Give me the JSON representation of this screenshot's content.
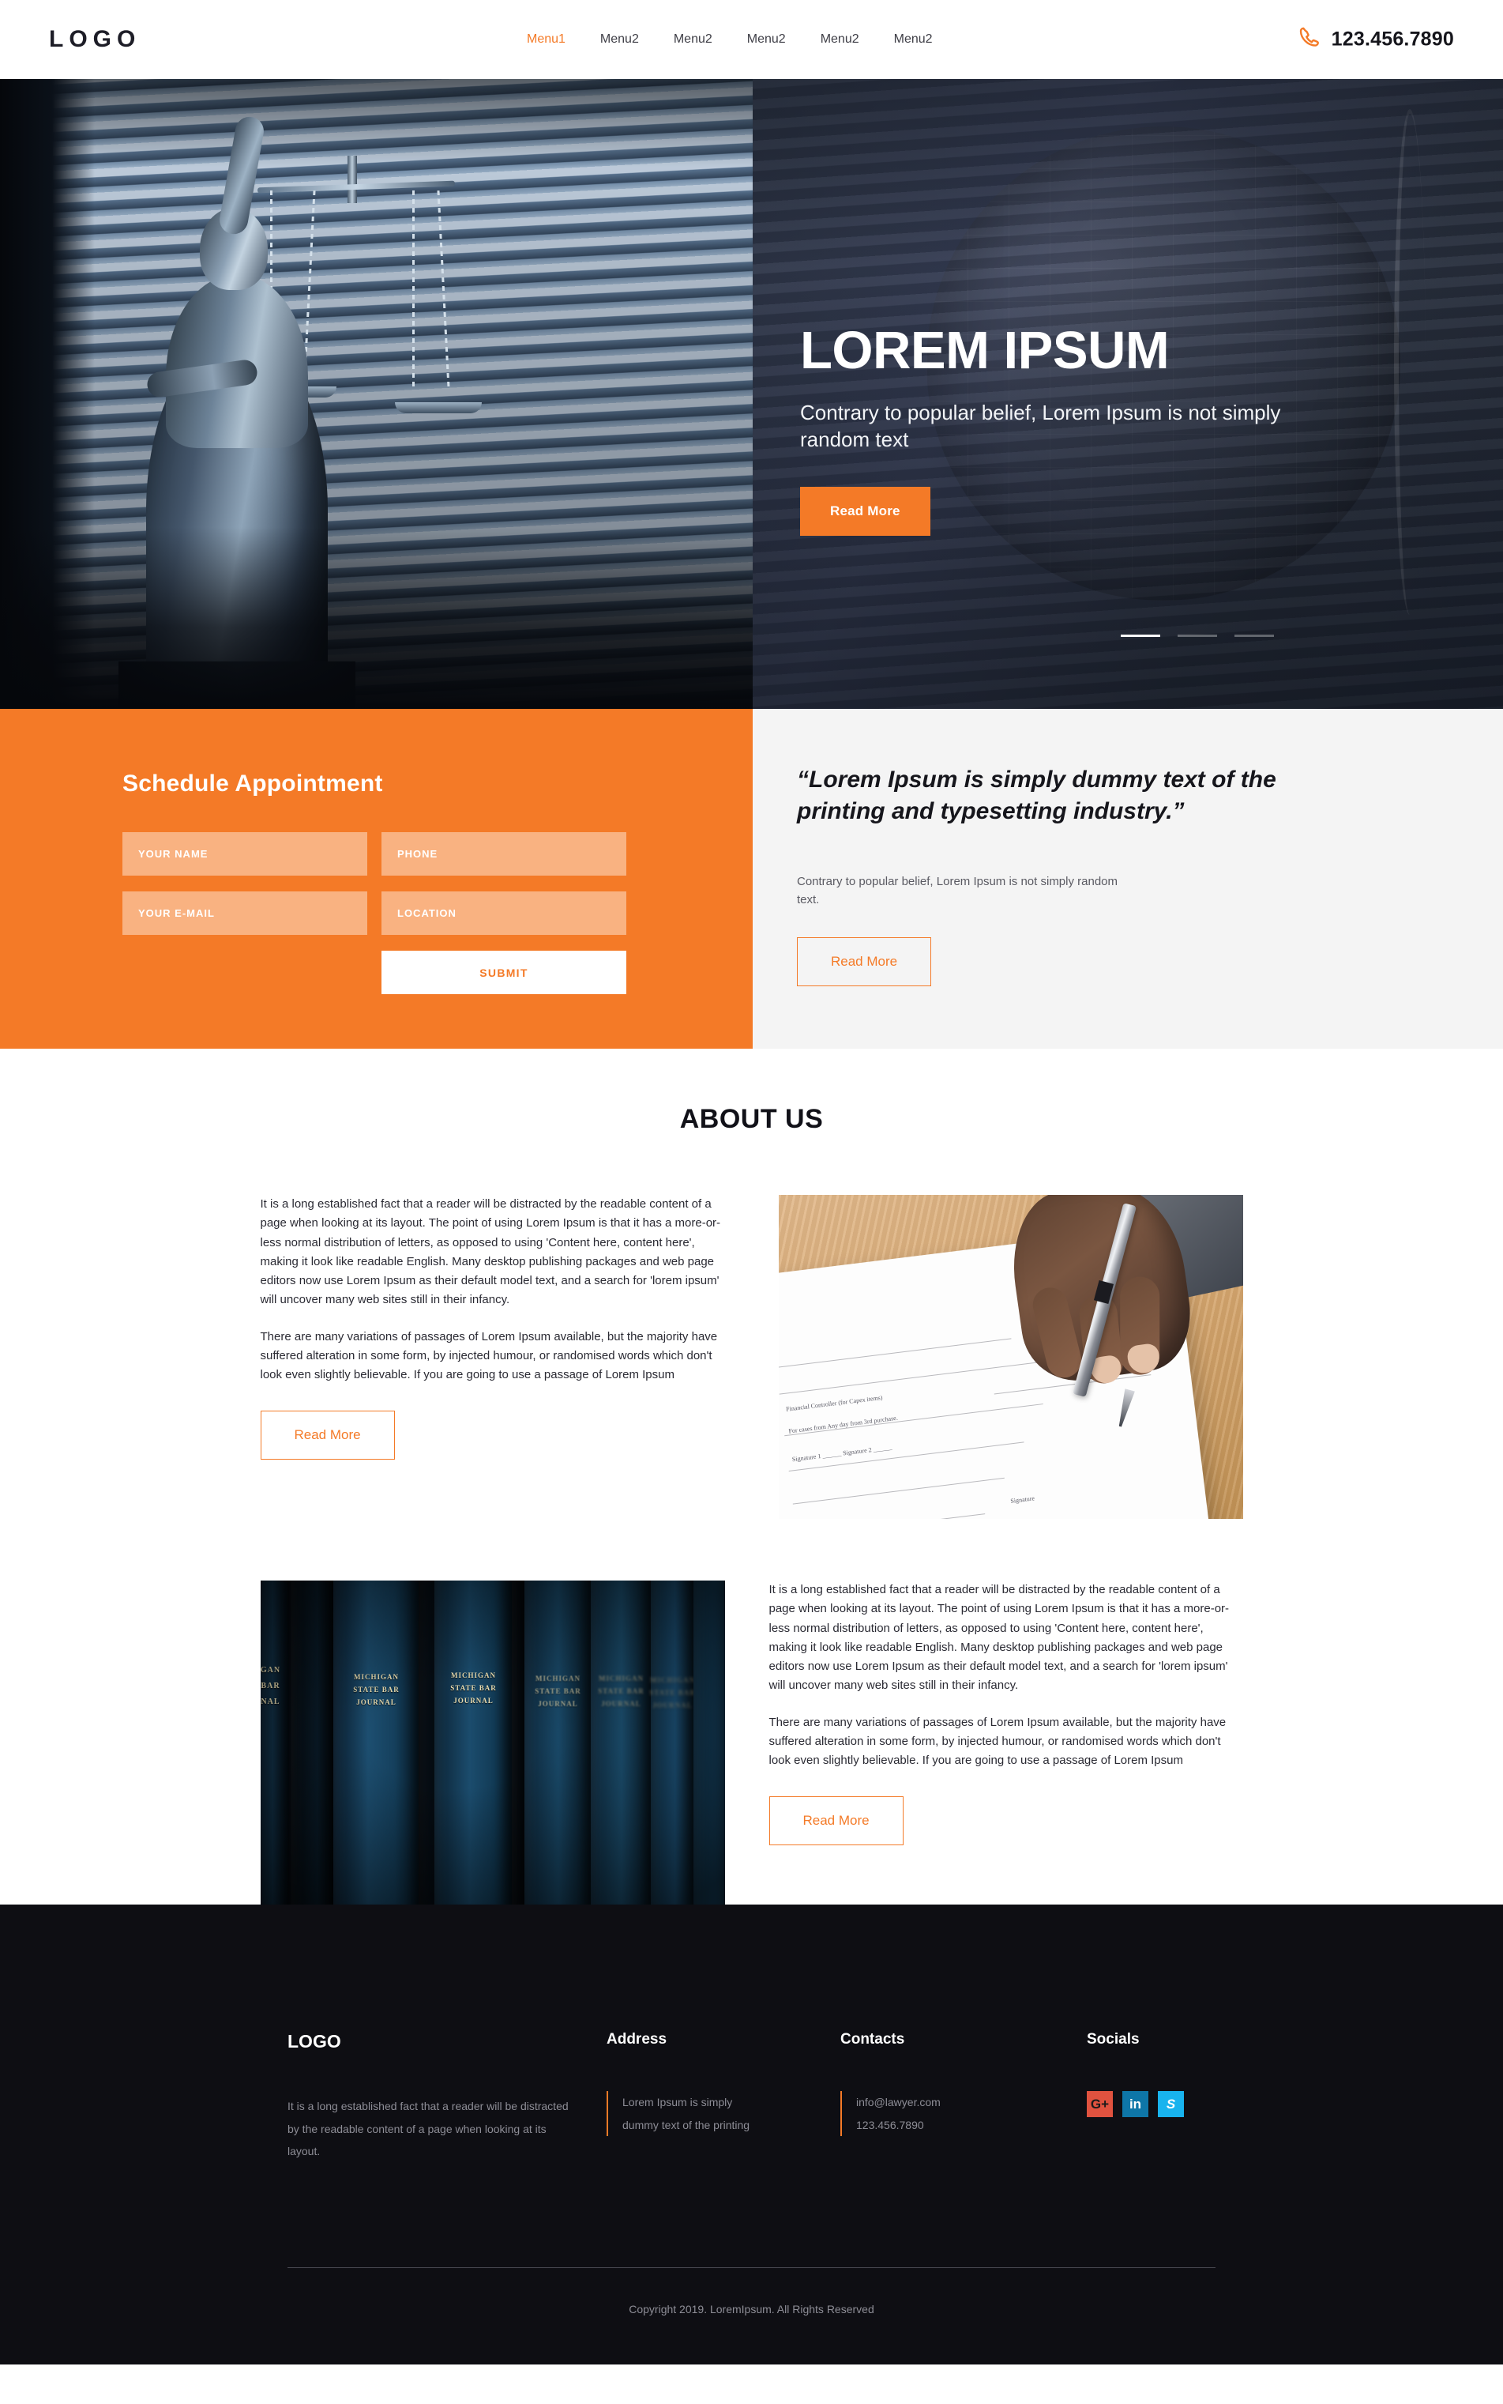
{
  "header": {
    "logo": "LOGO",
    "nav": [
      {
        "label": "Menu1",
        "active": true
      },
      {
        "label": "Menu2",
        "active": false
      },
      {
        "label": "Menu2",
        "active": false
      },
      {
        "label": "Menu2",
        "active": false
      },
      {
        "label": "Menu2",
        "active": false
      },
      {
        "label": "Menu2",
        "active": false
      }
    ],
    "phone": "123.456.7890",
    "phone_icon": "phone-icon"
  },
  "hero": {
    "title": "LOREM IPSUM",
    "subtitle": "Contrary to popular belief, Lorem Ipsum is not simply random text",
    "cta": "Read More",
    "slides": [
      {
        "active": true
      },
      {
        "active": false
      },
      {
        "active": false
      }
    ],
    "left_image_alt": "lady-justice-statue-blinds",
    "right_image_alt": "globe-behind-blinds"
  },
  "appointment": {
    "title": "Schedule Appointment",
    "fields": [
      {
        "name": "your-name",
        "placeholder": "YOUR NAME",
        "value": ""
      },
      {
        "name": "phone",
        "placeholder": "PHONE",
        "value": ""
      },
      {
        "name": "your-email",
        "placeholder": "YOUR E-MAIL",
        "value": ""
      },
      {
        "name": "location",
        "placeholder": "LOCATION",
        "value": ""
      }
    ],
    "submit": "SUBMIT"
  },
  "quote_panel": {
    "quote": "“Lorem Ipsum is simply dummy text of the printing and typesetting industry.”",
    "body": "Contrary to popular belief, Lorem Ipsum is not simply random text.",
    "cta": "Read More"
  },
  "about": {
    "title": "ABOUT US",
    "block1": {
      "p1": "It is a long established fact that a reader will be distracted by the readable content of a page when looking at its layout. The point of using Lorem Ipsum is that it has a more-or-less normal distribution of letters, as opposed to using 'Content here, content here', making it look like readable English. Many desktop publishing packages and web page editors now use Lorem Ipsum as their default model text, and a search for 'lorem ipsum' will uncover many web sites still in their infancy.",
      "p2": "There are many variations of passages of Lorem Ipsum available, but the majority have suffered alteration in some form, by injected humour, or randomised words which don't look even slightly believable. If you are going to use a passage of Lorem Ipsum",
      "cta": "Read More",
      "image_alt": "hand-signing-document"
    },
    "block2": {
      "p1": "It is a long established fact that a reader will be distracted by the readable content of a page when looking at its layout. The point of using Lorem Ipsum is that it has a more-or-less normal distribution of letters, as opposed to using 'Content here, content here', making it look like readable English. Many desktop publishing packages and web page editors now use Lorem Ipsum as their default model text, and a search for 'lorem ipsum' will uncover many web sites still in their infancy.",
      "p2": "There are many variations of passages of Lorem Ipsum available, but the majority have suffered alteration in some form, by injected humour, or randomised words which don't look even slightly believable. If you are going to use a passage of Lorem Ipsum",
      "cta": "Read More",
      "image_alt": "michigan-state-bar-journal-books",
      "book_labels": [
        "MICHIGAN STATE BAR JOURNAL",
        "MICHIGAN STATE BAR JOURNAL"
      ]
    }
  },
  "footer": {
    "logo": "LOGO",
    "logo_text": "It is a long established fact that a reader will be distracted by the readable content of a page when looking at its layout.",
    "address_head": "Address",
    "address_text": "Lorem Ipsum is simply dummy text of the printing",
    "contacts_head": "Contacts",
    "contacts_email": "info@lawyer.com",
    "contacts_phone": "123.456.7890",
    "socials_head": "Socials",
    "socials": [
      {
        "name": "google-plus-icon",
        "glyph": "G+",
        "color": "#e0523f"
      },
      {
        "name": "linkedin-icon",
        "glyph": "in",
        "color": "#0e76a8"
      },
      {
        "name": "skype-icon",
        "glyph": "S",
        "color": "#18b3ee"
      }
    ],
    "copyright": "Copyright 2019. LoremIpsum. All Rights Reserved"
  },
  "colors": {
    "accent": "#f47a27",
    "dark": "#0e0e13",
    "panel": "#f4f4f4"
  }
}
